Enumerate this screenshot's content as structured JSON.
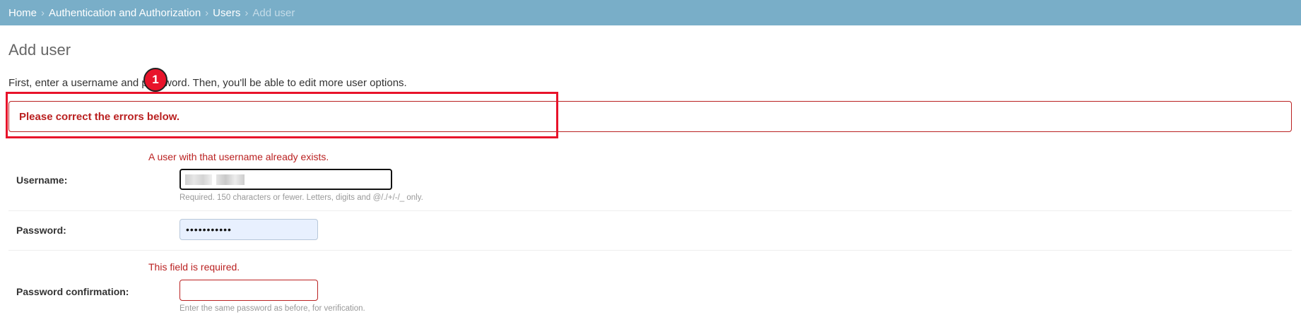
{
  "breadcrumbs": {
    "home": "Home",
    "sep": "›",
    "app": "Authentication and Authorization",
    "model": "Users",
    "current": "Add user"
  },
  "page": {
    "title": "Add user",
    "intro": "First, enter a username and password. Then, you'll be able to edit more user options.",
    "error_note": "Please correct the errors below."
  },
  "annotation": {
    "marker_number": "1"
  },
  "fields": {
    "username": {
      "error": "A user with that username already exists.",
      "label": "Username:",
      "help": "Required. 150 characters or fewer. Letters, digits and @/./+/-/_ only."
    },
    "password": {
      "label": "Password:",
      "masked_value": "•••••••••••"
    },
    "password_confirmation": {
      "error": "This field is required.",
      "label": "Password confirmation:",
      "help": "Enter the same password as before, for verification."
    }
  },
  "colors": {
    "header_bg": "#79aec8",
    "error": "#ba2121",
    "highlight": "#e8132a",
    "autofill_bg": "#e8f0fe"
  }
}
